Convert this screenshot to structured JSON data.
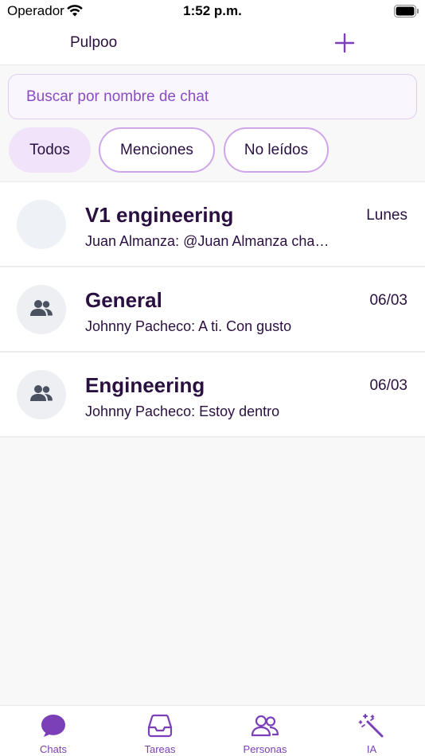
{
  "status_bar": {
    "carrier": "Operador",
    "time": "1:52 p.m."
  },
  "header": {
    "title": "Pulpoo",
    "add_icon": "plus-icon"
  },
  "search": {
    "placeholder": "Buscar por nombre de chat",
    "value": ""
  },
  "filters": [
    {
      "label": "Todos",
      "active": true
    },
    {
      "label": "Menciones",
      "active": false
    },
    {
      "label": "No leídos",
      "active": false
    }
  ],
  "chats": [
    {
      "name": "V1 engineering",
      "date": "Lunes",
      "preview": "Juan Almanza: @Juan Almanza cha…",
      "avatar": "blank"
    },
    {
      "name": "General",
      "date": "06/03",
      "preview": "Johnny Pacheco: A ti. Con gusto",
      "avatar": "group-icon"
    },
    {
      "name": "Engineering",
      "date": "06/03",
      "preview": "Johnny Pacheco: Estoy dentro",
      "avatar": "group-icon"
    }
  ],
  "tabbar": {
    "tabs": [
      {
        "label": "Chats",
        "icon": "chat-bubble-icon",
        "active": true
      },
      {
        "label": "Tareas",
        "icon": "inbox-tray-icon",
        "active": false
      },
      {
        "label": "Personas",
        "icon": "people-icon",
        "active": false
      },
      {
        "label": "IA",
        "icon": "magic-wand-icon",
        "active": false
      }
    ]
  },
  "colors": {
    "accent": "#7b3fb8",
    "text": "#2a1040",
    "filter_active_bg": "#f1e4fa",
    "filter_border": "#cfa6ec"
  }
}
